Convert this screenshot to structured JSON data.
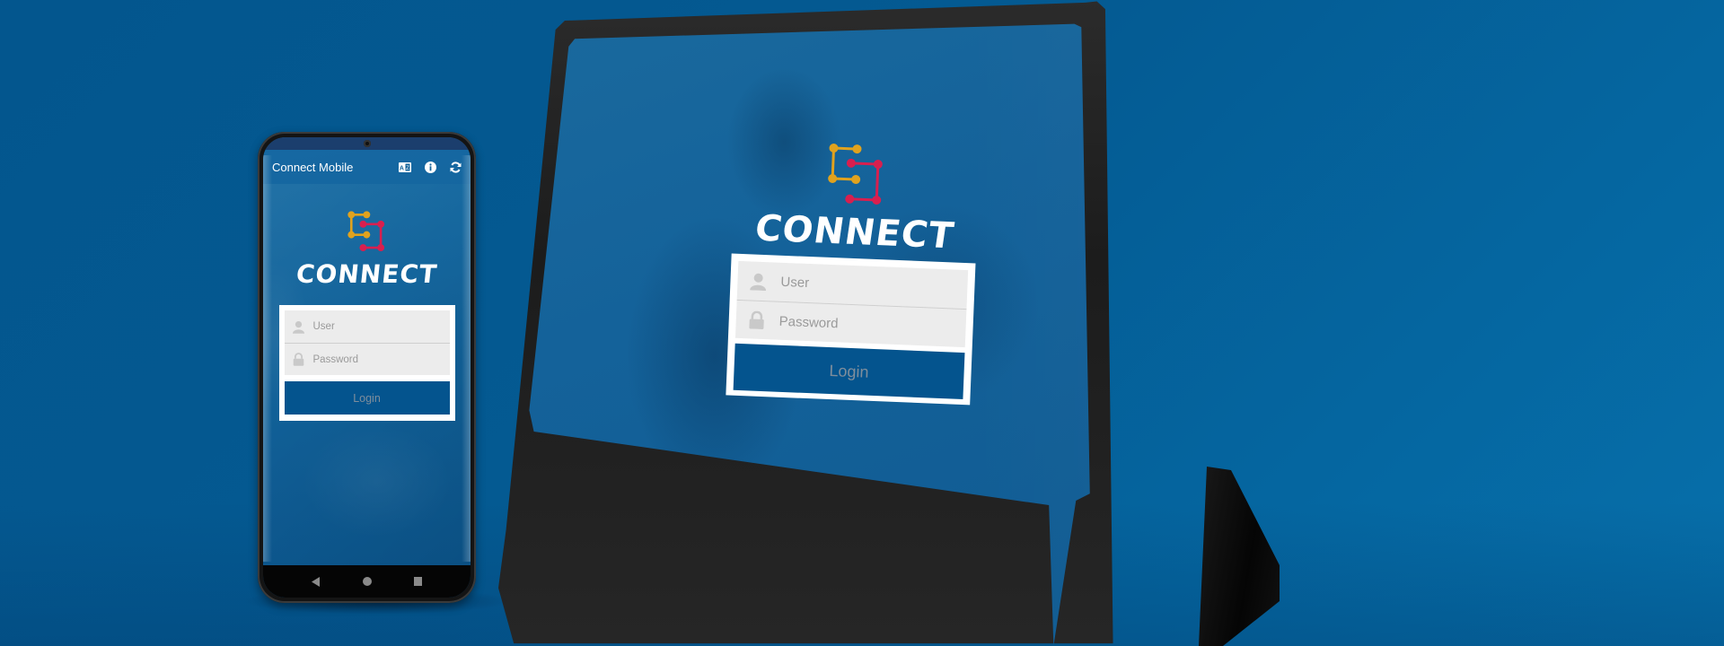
{
  "scene": {
    "background_color": "#045a92",
    "brand_primary": "#04548e",
    "logo_colors": {
      "gold": "#e0a21e",
      "crimson": "#d81f4f"
    }
  },
  "phone": {
    "app_bar": {
      "title": "Connect Mobile",
      "actions": [
        {
          "icon": "translate-icon",
          "glyph": "A文"
        },
        {
          "icon": "info-icon",
          "glyph": "i"
        },
        {
          "icon": "refresh-icon",
          "glyph": "⟳"
        }
      ]
    },
    "brand": {
      "wordmark": "CONNECT"
    },
    "login_form": {
      "user_placeholder": "User",
      "password_placeholder": "Password",
      "login_label": "Login"
    },
    "nav_bar": [
      "back",
      "home",
      "recents"
    ]
  },
  "tablet": {
    "brand": {
      "wordmark": "CONNECT"
    },
    "login_form": {
      "user_placeholder": "User",
      "password_placeholder": "Password",
      "login_label": "Login"
    }
  }
}
